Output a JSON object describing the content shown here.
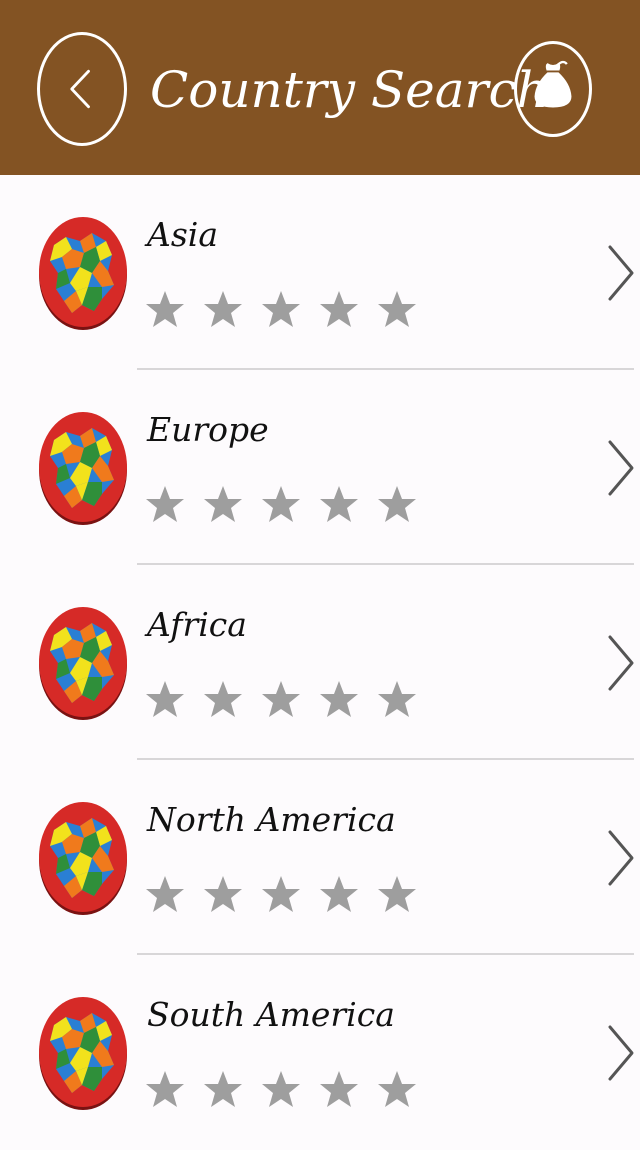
{
  "header": {
    "title": "Country Search",
    "back_icon": "chevron-left-icon",
    "bag_icon": "money-bag-icon",
    "background_color": "#835323"
  },
  "list": {
    "items": [
      {
        "label": "Asia",
        "icon": "map-icon",
        "rating": 0,
        "max_rating": 5
      },
      {
        "label": "Europe",
        "icon": "map-icon",
        "rating": 0,
        "max_rating": 5
      },
      {
        "label": "Africa",
        "icon": "map-icon",
        "rating": 0,
        "max_rating": 5
      },
      {
        "label": "North America",
        "icon": "map-icon",
        "rating": 0,
        "max_rating": 5
      },
      {
        "label": "South America",
        "icon": "map-icon",
        "rating": 0,
        "max_rating": 5
      }
    ],
    "star_empty_color": "#9e9e9e"
  }
}
